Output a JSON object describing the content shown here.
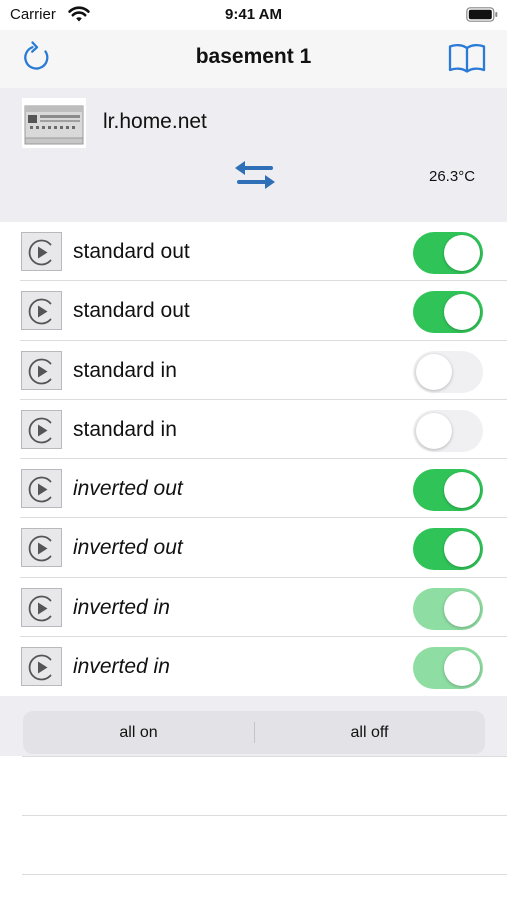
{
  "status_bar": {
    "carrier": "Carrier",
    "time": "9:41 AM"
  },
  "nav": {
    "title": "basement 1",
    "refresh_icon": "refresh-icon",
    "book_icon": "book-icon"
  },
  "device": {
    "host": "lr.home.net",
    "temperature": "26.3°C"
  },
  "switches": [
    {
      "label": "standard out",
      "state": "on",
      "italic": false,
      "icon": "play-circle-icon"
    },
    {
      "label": "standard out",
      "state": "on",
      "italic": false,
      "icon": "play-circle-icon"
    },
    {
      "label": "standard in",
      "state": "off",
      "italic": false,
      "icon": "play-circle-icon"
    },
    {
      "label": "standard in",
      "state": "off",
      "italic": false,
      "icon": "play-circle-icon"
    },
    {
      "label": "inverted out",
      "state": "on",
      "italic": true,
      "icon": "play-circle-icon"
    },
    {
      "label": "inverted out",
      "state": "on",
      "italic": true,
      "icon": "play-circle-icon"
    },
    {
      "label": "inverted in",
      "state": "on-disabled",
      "italic": true,
      "icon": "play-circle-icon"
    },
    {
      "label": "inverted in",
      "state": "on-disabled",
      "italic": true,
      "icon": "play-circle-icon"
    }
  ],
  "footer": {
    "all_on": "all on",
    "all_off": "all off"
  },
  "colors": {
    "accent": "#2a7bd6",
    "switch_on": "#30c458",
    "switch_on_disabled": "#8edda2",
    "switch_off": "#f0f0f2"
  }
}
